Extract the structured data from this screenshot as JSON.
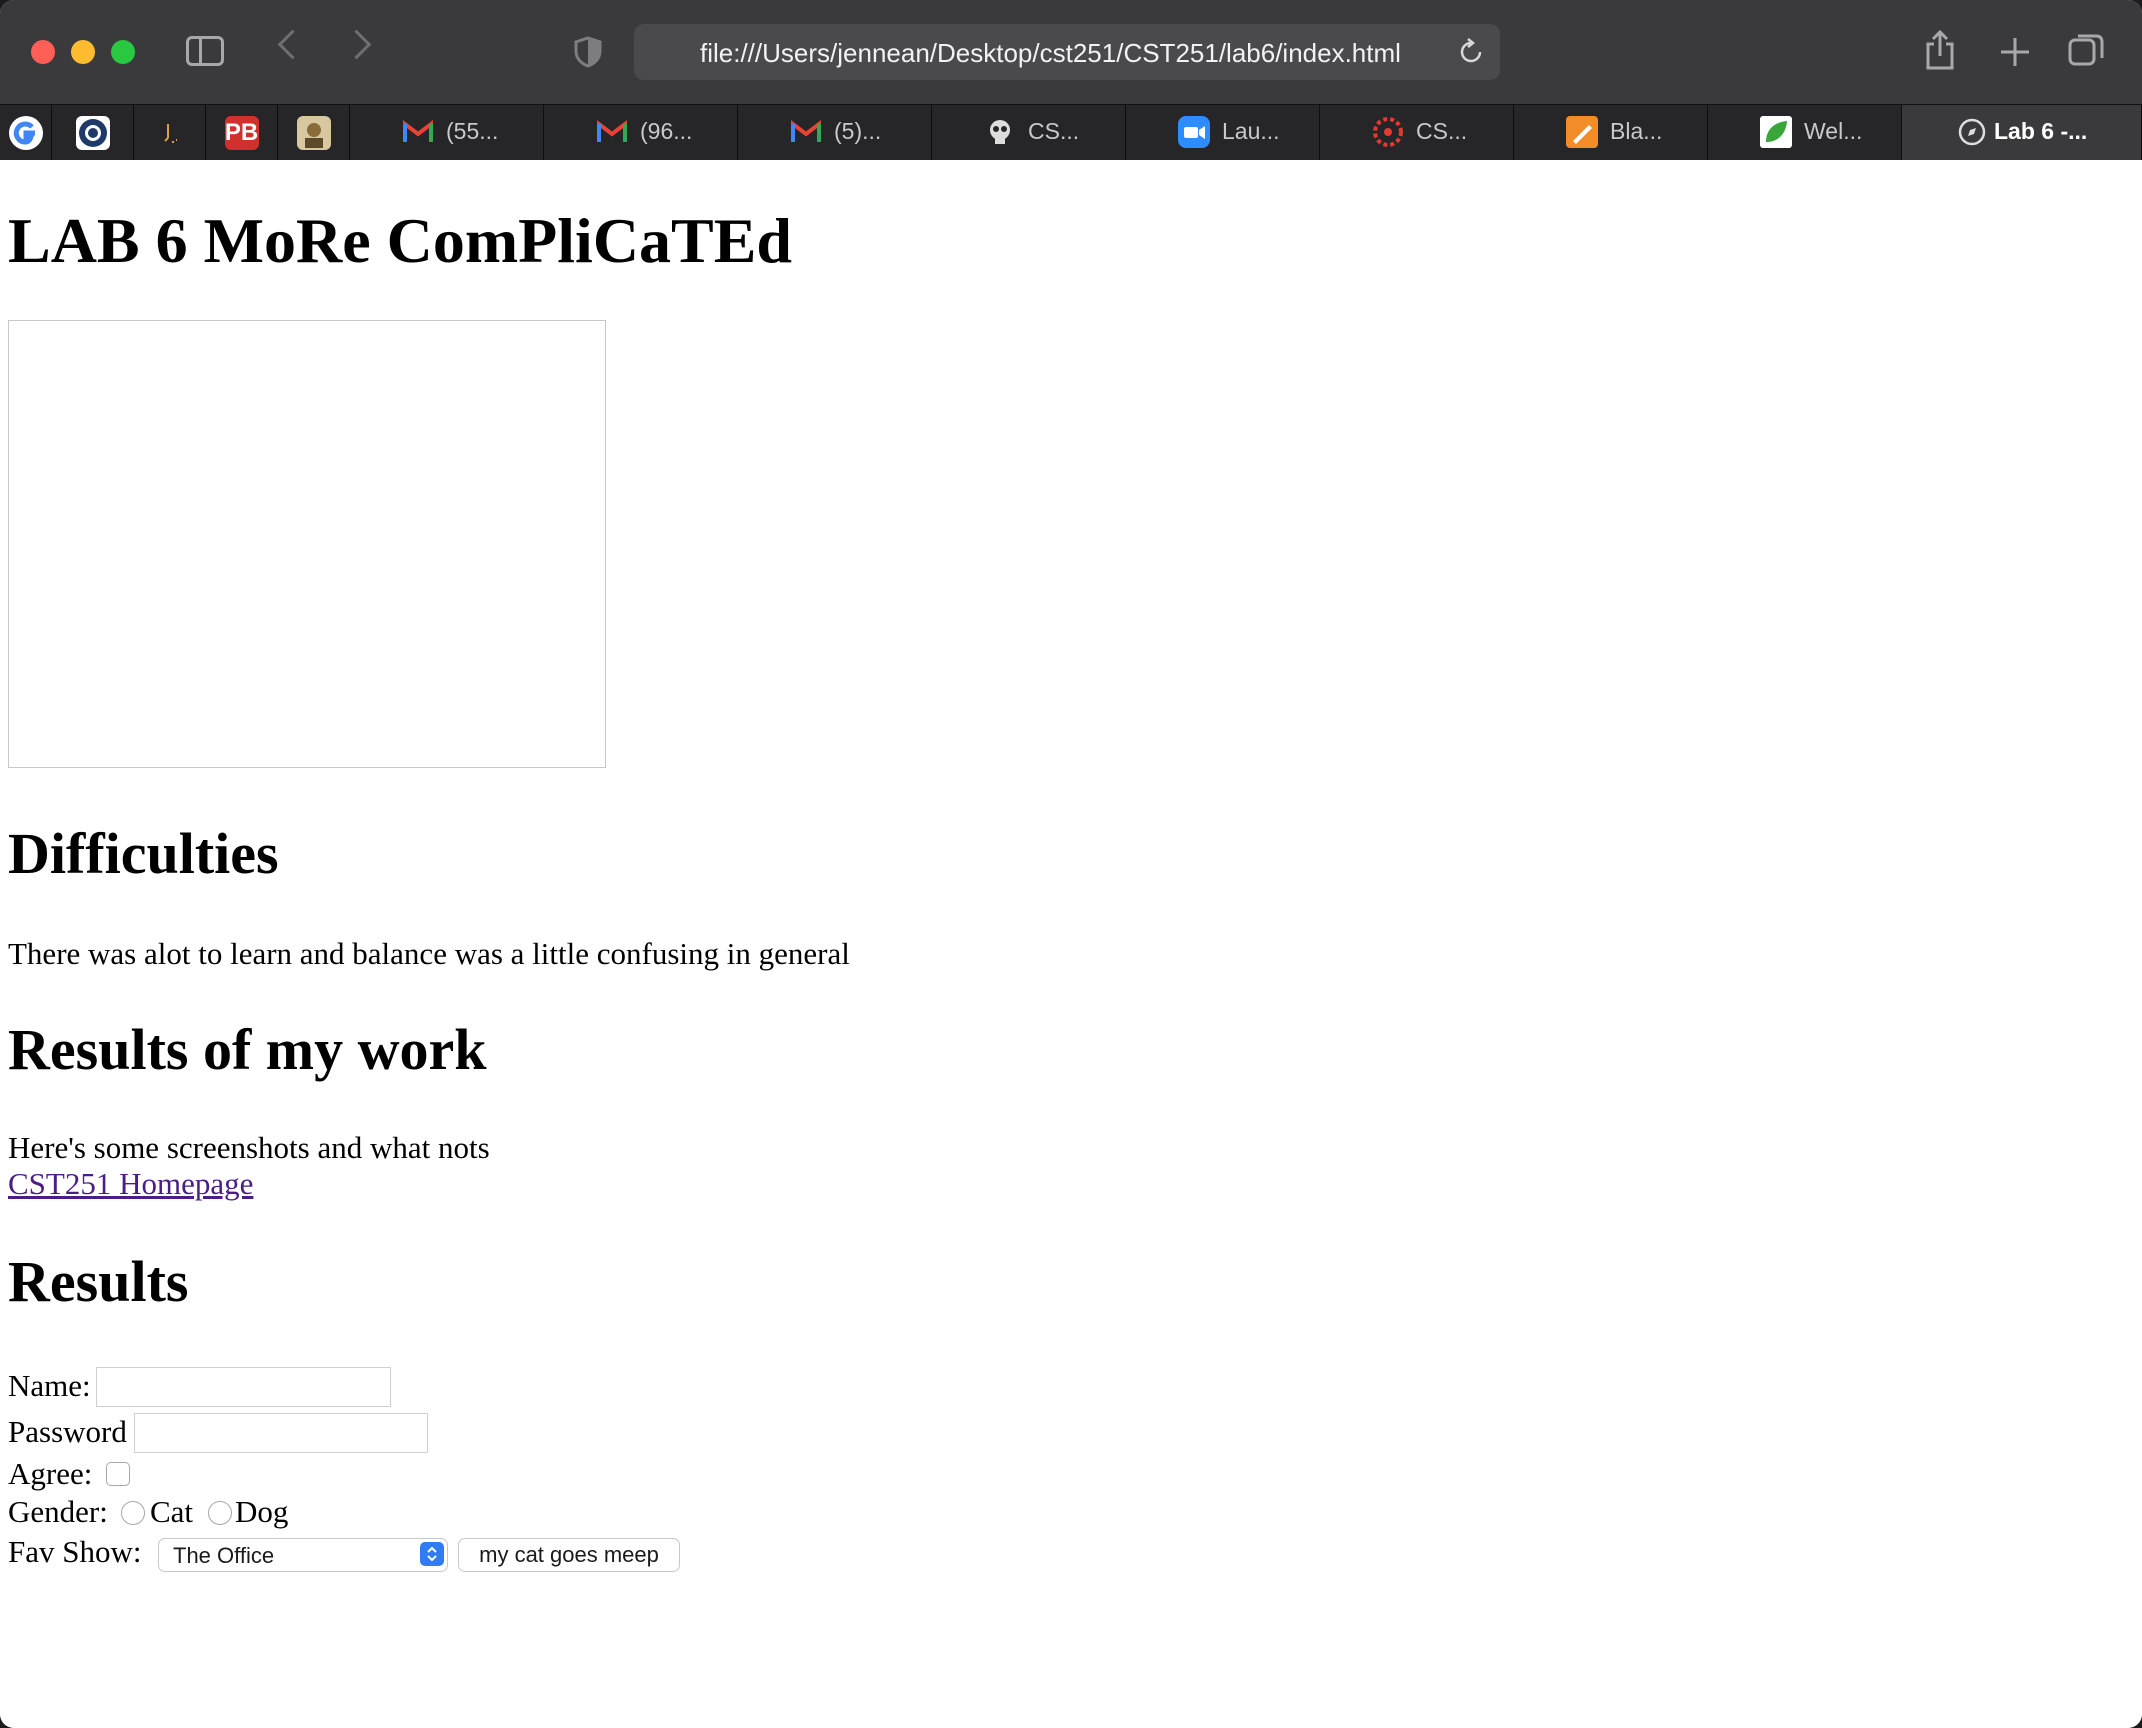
{
  "browser": {
    "url": "file:///Users/jennean/Desktop/cst251/CST251/lab6/index.html",
    "pinned_tabs": [
      "google-icon",
      "circle-app-icon",
      "sparkle-icon",
      "pb-icon",
      "photo-icon"
    ],
    "pinned_pb_text": "PB",
    "tabs": [
      {
        "icon": "gmail-icon",
        "label": "(55..."
      },
      {
        "icon": "gmail-icon",
        "label": "(96..."
      },
      {
        "icon": "gmail-icon",
        "label": "(5)..."
      },
      {
        "icon": "skull-icon",
        "label": "CS..."
      },
      {
        "icon": "zoom-icon",
        "label": "Lau..."
      },
      {
        "icon": "canvas-icon",
        "label": "CS..."
      },
      {
        "icon": "pencil-icon",
        "label": "Bla..."
      },
      {
        "icon": "leaf-icon",
        "label": "Wel..."
      },
      {
        "icon": "compass-icon",
        "label": "Lab 6 -..."
      }
    ],
    "colors": {
      "toolbar": "#3a3a3c",
      "tabbar": "#262628",
      "link_visited": "#4b1e86",
      "select_accent": "#2f7cf6"
    }
  },
  "page": {
    "title": "LAB 6 MoRe ComPliCaTEd",
    "difficulties_heading": "Difficulties",
    "difficulties_text": "There was alot to learn and balance was a little confusing in general",
    "results_work_heading": "Results of my work",
    "results_work_text": "Here's some screenshots and what nots",
    "homepage_link": "CST251 Homepage",
    "results_heading": "Results",
    "form": {
      "name_label": "Name:",
      "name_value": "",
      "password_label": "Password",
      "password_value": "",
      "agree_label": "Agree:",
      "agree_checked": false,
      "gender_label": "Gender:",
      "gender_options": [
        "Cat",
        "Dog"
      ],
      "fav_show_label": "Fav Show:",
      "fav_show_selected": "The Office",
      "button_label": "my cat goes meep"
    }
  }
}
